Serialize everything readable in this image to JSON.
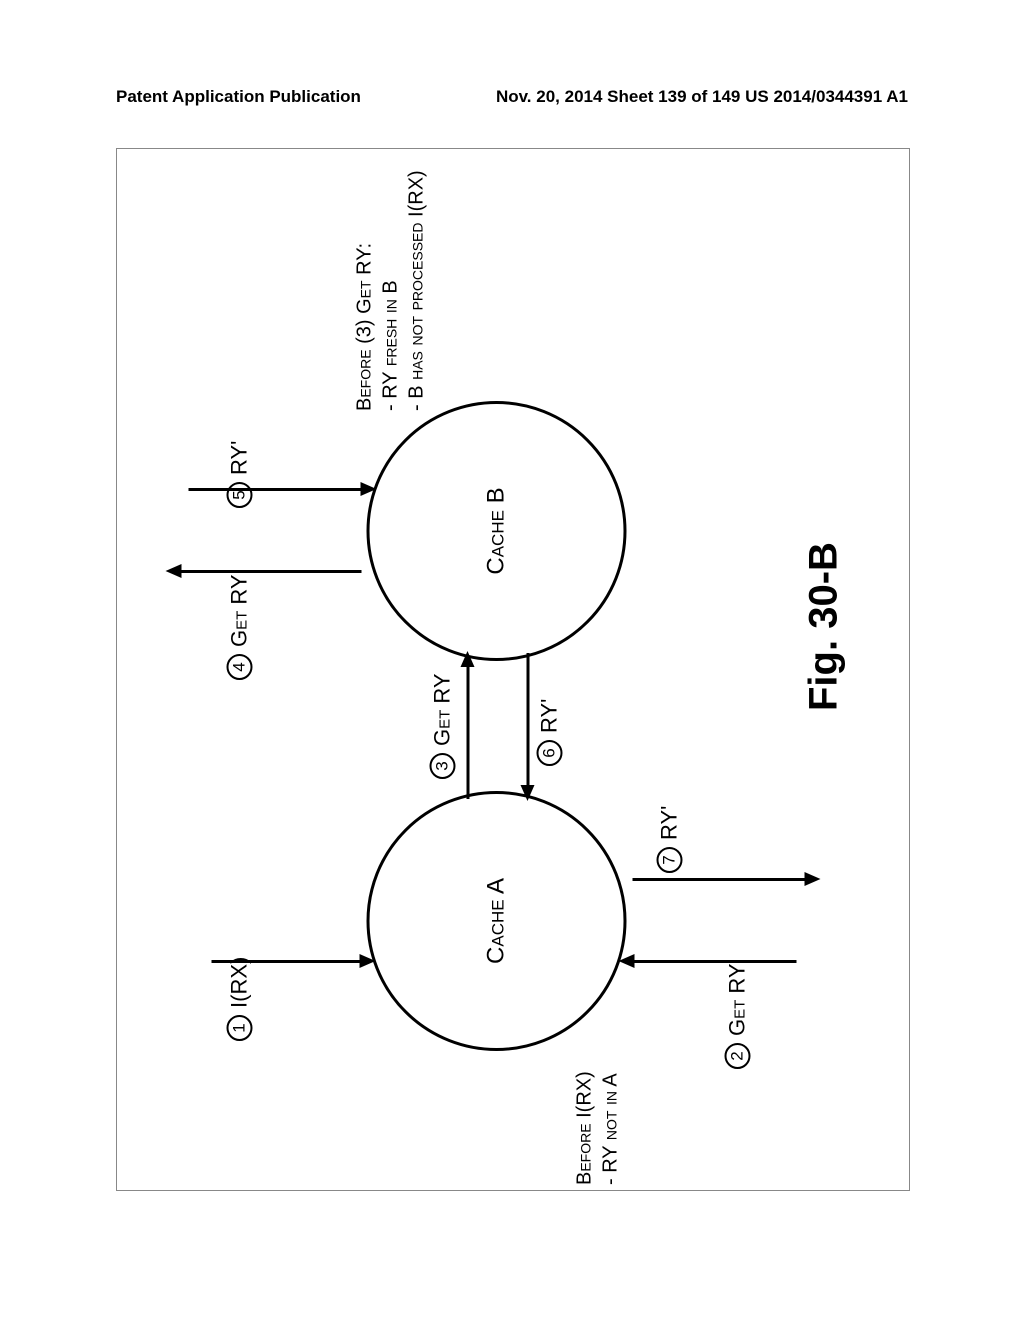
{
  "header": {
    "left": "Patent Application Publication",
    "right": "Nov. 20, 2014   Sheet 139 of 149   US 2014/0344391 A1"
  },
  "diagram": {
    "cache_a": "Cache A",
    "cache_b": "Cache B",
    "steps": {
      "s1": {
        "num": "1",
        "text": "I(RX)"
      },
      "s2": {
        "num": "2",
        "text": "Get RY"
      },
      "s3": {
        "num": "3",
        "text": "Get RY"
      },
      "s4": {
        "num": "4",
        "text": "Get RY"
      },
      "s5": {
        "num": "5",
        "text": "RY'"
      },
      "s6": {
        "num": "6",
        "text": "RY'"
      },
      "s7": {
        "num": "7",
        "text": "RY'"
      }
    },
    "note_a": "Before I(RX)\n- RY not in A",
    "note_b": "Before (3) Get RY:\n- RY fresh in B\n- B has not processed I(RX)",
    "figure_label": "Fig. 30-B"
  }
}
